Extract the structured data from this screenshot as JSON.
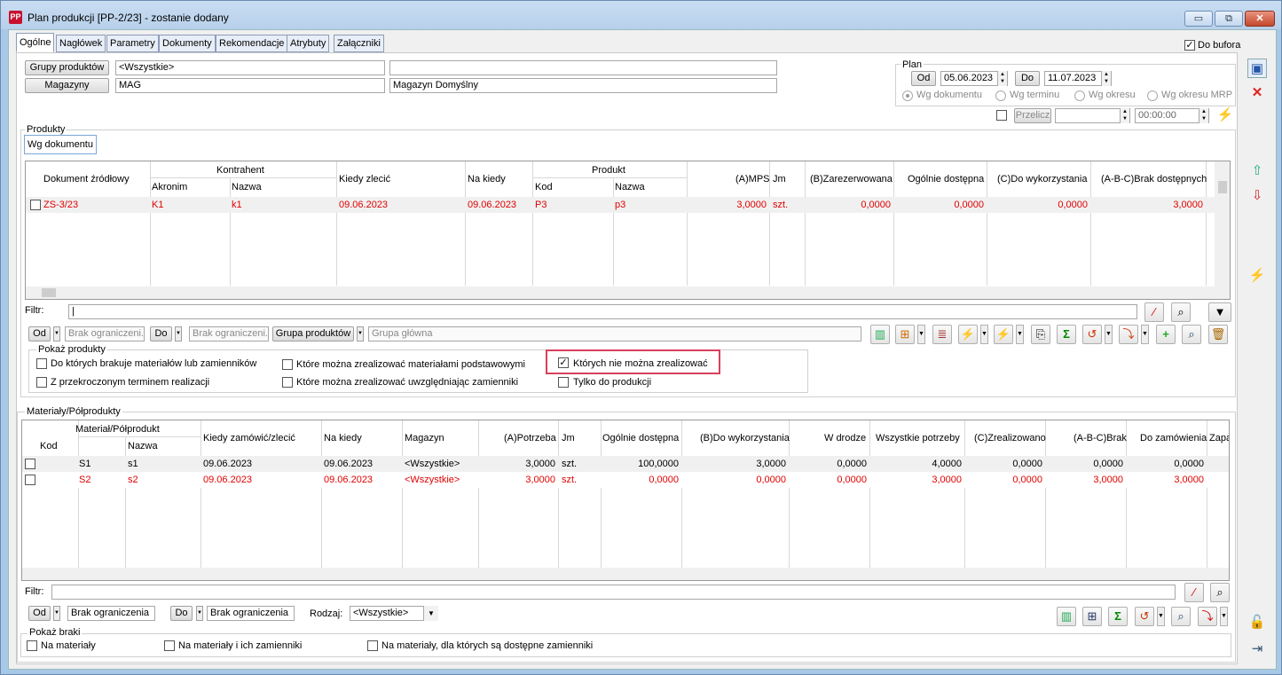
{
  "window": {
    "title": "Plan produkcji [PP-2/23] - zostanie dodany",
    "icon_label": "PP",
    "minimize": "▭",
    "restore": "⧉",
    "close": "✕"
  },
  "tabs": [
    "Ogólne",
    "Nagłówek",
    "Parametry",
    "Dokumenty",
    "Rekomendacje",
    "Atrybuty",
    "Załączniki"
  ],
  "do_bufora": {
    "label": "Do bufora",
    "checked": true
  },
  "filters": {
    "grupy_btn": "Grupy produktów",
    "grupy_value": "<Wszystkie>",
    "grupy_desc": "",
    "magazyny_btn": "Magazyny",
    "magazyny_value": "MAG",
    "magazyny_desc": "Magazyn Domyślny"
  },
  "plan": {
    "label": "Plan",
    "od_btn": "Od",
    "od_value": "05.06.2023",
    "do_btn": "Do",
    "do_value": "11.07.2023",
    "radios": [
      "Wg dokumentu",
      "Wg terminu",
      "Wg okresu",
      "Wg okresu MRP"
    ],
    "przelicz_btn": "Przelicz",
    "przelicz_date": "",
    "przelicz_time": "00:00:00"
  },
  "produkty": {
    "label": "Produkty",
    "subtab": "Wg dokumentu",
    "headers": {
      "dokument": "Dokument źródłowy",
      "kontrahent": "Kontrahent",
      "akronim": "Akronim",
      "nazwa": "Nazwa",
      "kiedy": "Kiedy zlecić",
      "na_kiedy": "Na kiedy",
      "produkt": "Produkt",
      "kod": "Kod",
      "pnazwa": "Nazwa",
      "mps": "(A)MPS",
      "jm": "Jm",
      "zarez": "(B)Zarezerwowana",
      "ogolnie": "Ogólnie dostępna",
      "dowyk": "(C)Do wykorzystania",
      "brak": "(A-B-C)Brak dostępnych"
    },
    "rows": [
      {
        "dokument": "ZS-3/23",
        "akronim": "K1",
        "nazwa": "k1",
        "kiedy": "09.06.2023",
        "na_kiedy": "09.06.2023",
        "kod": "P3",
        "pnazwa": "p3",
        "mps": "3,0000",
        "jm": "szt.",
        "zarez": "0,0000",
        "ogolnie": "0,0000",
        "dowyk": "0,0000",
        "brak": "3,0000"
      }
    ],
    "filtr_label": "Filtr:",
    "filtr_value": "|",
    "od_btn": "Od",
    "od_value": "Brak ograniczeni.",
    "do_btn": "Do",
    "do_value": "Brak ograniczeni.",
    "grupa_btn": "Grupa produktów",
    "grupa_value": "Grupa główna",
    "pokaz_label": "Pokaż produkty",
    "checks": [
      {
        "label": "Do których brakuje materiałów lub zamienników",
        "checked": false
      },
      {
        "label": "Z przekroczonym terminem realizacji",
        "checked": false
      },
      {
        "label": "Które można zrealizować materiałami podstawowymi",
        "checked": false
      },
      {
        "label": "Które można zrealizować uwzględniając zamienniki",
        "checked": false
      },
      {
        "label": "Których nie można zrealizować",
        "checked": true
      },
      {
        "label": "Tylko do produkcji",
        "checked": false
      }
    ]
  },
  "materialy": {
    "label": "Materiały/Półprodukty",
    "headers": {
      "mat": "Materiał/Półprodukt",
      "kod": "Kod",
      "nazwa": "Nazwa",
      "kiedy": "Kiedy zamówić/zlecić",
      "na_kiedy": "Na kiedy",
      "magazyn": "Magazyn",
      "potrzeba": "(A)Potrzeba",
      "jm": "Jm",
      "ogolnie": "Ogólnie dostępna",
      "dowyk": "(B)Do wykorzystania",
      "wdrodze": "W drodze",
      "wszystkie": "Wszystkie potrzeby",
      "zreal": "(C)Zrealizowano",
      "brak": "(A-B-C)Brak",
      "dozam": "Do zamówienia",
      "zapas": "Zapa"
    },
    "rows": [
      {
        "kod": "S1",
        "nazwa": "s1",
        "kiedy": "09.06.2023",
        "na_kiedy": "09.06.2023",
        "magazyn": "<Wszystkie>",
        "potrzeba": "3,0000",
        "jm": "szt.",
        "ogolnie": "100,0000",
        "dowyk": "3,0000",
        "wdrodze": "0,0000",
        "wszystkie": "4,0000",
        "zreal": "0,0000",
        "brak": "0,0000",
        "dozam": "0,0000",
        "red": false
      },
      {
        "kod": "S2",
        "nazwa": "s2",
        "kiedy": "09.06.2023",
        "na_kiedy": "09.06.2023",
        "magazyn": "<Wszystkie>",
        "potrzeba": "3,0000",
        "jm": "szt.",
        "ogolnie": "0,0000",
        "dowyk": "0,0000",
        "wdrodze": "0,0000",
        "wszystkie": "3,0000",
        "zreal": "0,0000",
        "brak": "3,0000",
        "dozam": "3,0000",
        "red": true
      }
    ],
    "filtr_label": "Filtr:",
    "od_btn": "Od",
    "od_value": "Brak ograniczenia",
    "do_btn": "Do",
    "do_value": "Brak ograniczenia",
    "rodzaj_label": "Rodzaj:",
    "rodzaj_value": "<Wszystkie>",
    "pokaz_label": "Pokaż braki",
    "checks": [
      {
        "label": "Na materiały",
        "checked": false
      },
      {
        "label": "Na materiały i ich zamienniki",
        "checked": false
      },
      {
        "label": "Na materiały, dla których są dostępne zamienniki",
        "checked": false
      }
    ]
  },
  "colors": {
    "accent_red": "#e00000",
    "highlight_border": "#d8405a"
  }
}
